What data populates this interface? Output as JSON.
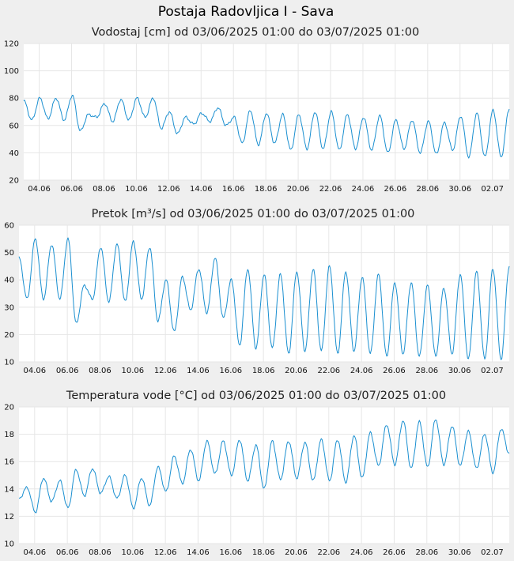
{
  "page": {
    "title": "Postaja Radovljica I - Sava"
  },
  "colors": {
    "series": "#1a8fd0",
    "background": "#efefef",
    "plot": "#ffffff",
    "grid": "#e6e6e6"
  },
  "chart_data": [
    {
      "type": "line",
      "title": "Vodostaj [cm] od 03/06/2025 01:00 do 03/07/2025 01:00",
      "xlabel": "",
      "ylabel": "",
      "ylim": [
        20,
        120
      ],
      "yticks": [
        "20",
        "40",
        "60",
        "80",
        "100",
        "120"
      ],
      "xticks": [
        "04.06",
        "06.06",
        "08.06",
        "10.06",
        "12.06",
        "14.06",
        "16.06",
        "18.06",
        "20.06",
        "22.06",
        "24.06",
        "26.06",
        "28.06",
        "30.06",
        "02.07"
      ],
      "grid": true,
      "x": [
        "03.06",
        "03.06 12h",
        "04.06",
        "04.06 12h",
        "05.06",
        "05.06 12h",
        "06.06",
        "06.06 12h",
        "07.06",
        "07.06 12h",
        "08.06",
        "08.06 12h",
        "09.06",
        "09.06 12h",
        "10.06",
        "10.06 12h",
        "11.06",
        "11.06 12h",
        "12.06",
        "12.06 12h",
        "13.06",
        "13.06 12h",
        "14.06",
        "14.06 12h",
        "15.06",
        "15.06 12h",
        "16.06",
        "16.06 12h",
        "17.06",
        "17.06 12h",
        "18.06",
        "18.06 12h",
        "19.06",
        "19.06 12h",
        "20.06",
        "20.06 12h",
        "21.06",
        "21.06 12h",
        "22.06",
        "22.06 12h",
        "23.06",
        "23.06 12h",
        "24.06",
        "24.06 12h",
        "25.06",
        "25.06 12h",
        "26.06",
        "26.06 12h",
        "27.06",
        "27.06 12h",
        "28.06",
        "28.06 12h",
        "29.06",
        "29.06 12h",
        "30.06",
        "30.06 12h",
        "01.07",
        "01.07 12h",
        "02.07",
        "02.07 12h",
        "03.07"
      ],
      "series": [
        {
          "values": [
            78,
            64,
            80,
            65,
            80,
            64,
            82,
            56,
            68,
            66,
            76,
            63,
            79,
            64,
            80,
            66,
            80,
            58,
            70,
            54,
            66,
            61,
            69,
            63,
            73,
            60,
            66,
            47,
            71,
            46,
            69,
            47,
            68,
            42,
            68,
            43,
            70,
            43,
            70,
            42,
            68,
            43,
            66,
            42,
            67,
            40,
            64,
            43,
            64,
            40,
            63,
            39,
            62,
            42,
            67,
            37,
            69,
            37,
            71,
            37,
            72
          ]
        }
      ]
    },
    {
      "type": "line",
      "title": "Pretok [m³/s] od 03/06/2025 01:00 do 03/07/2025 01:00",
      "xlabel": "",
      "ylabel": "",
      "ylim": [
        10,
        60
      ],
      "yticks": [
        "10",
        "20",
        "30",
        "40",
        "50",
        "60"
      ],
      "xticks": [
        "04.06",
        "06.06",
        "08.06",
        "10.06",
        "12.06",
        "14.06",
        "16.06",
        "18.06",
        "20.06",
        "22.06",
        "24.06",
        "26.06",
        "28.06",
        "30.06",
        "02.07"
      ],
      "grid": true,
      "x": [
        "03.06",
        "03.06 12h",
        "04.06",
        "04.06 12h",
        "05.06",
        "05.06 12h",
        "06.06",
        "06.06 12h",
        "07.06",
        "07.06 12h",
        "08.06",
        "08.06 12h",
        "09.06",
        "09.06 12h",
        "10.06",
        "10.06 12h",
        "11.06",
        "11.06 12h",
        "12.06",
        "12.06 12h",
        "13.06",
        "13.06 12h",
        "14.06",
        "14.06 12h",
        "15.06",
        "15.06 12h",
        "16.06",
        "16.06 12h",
        "17.06",
        "17.06 12h",
        "18.06",
        "18.06 12h",
        "19.06",
        "19.06 12h",
        "20.06",
        "20.06 12h",
        "21.06",
        "21.06 12h",
        "22.06",
        "22.06 12h",
        "23.06",
        "23.06 12h",
        "24.06",
        "24.06 12h",
        "25.06",
        "25.06 12h",
        "26.06",
        "26.06 12h",
        "27.06",
        "27.06 12h",
        "28.06",
        "28.06 12h",
        "29.06",
        "29.06 12h",
        "30.06",
        "30.06 12h",
        "01.07",
        "01.07 12h",
        "02.07",
        "02.07 12h",
        "03.07"
      ],
      "series": [
        {
          "values": [
            48,
            33,
            55,
            33,
            53,
            33,
            55,
            24,
            38,
            33,
            52,
            32,
            53,
            32,
            54,
            33,
            52,
            25,
            40,
            21,
            41,
            29,
            44,
            28,
            48,
            26,
            40,
            16,
            44,
            15,
            42,
            15,
            42,
            13,
            43,
            14,
            44,
            14,
            45,
            13,
            43,
            14,
            41,
            13,
            42,
            12,
            39,
            13,
            39,
            12,
            38,
            12,
            37,
            13,
            42,
            11,
            43,
            11,
            44,
            11,
            45
          ]
        }
      ]
    },
    {
      "type": "line",
      "title": "Temperatura vode [°C] od 03/06/2025 01:00 do 03/07/2025 01:00",
      "xlabel": "",
      "ylabel": "",
      "ylim": [
        10,
        20
      ],
      "yticks": [
        "10",
        "12",
        "14",
        "16",
        "18",
        "20"
      ],
      "xticks": [
        "04.06",
        "06.06",
        "08.06",
        "10.06",
        "12.06",
        "14.06",
        "16.06",
        "18.06",
        "20.06",
        "22.06",
        "24.06",
        "26.06",
        "28.06",
        "30.06",
        "02.07"
      ],
      "grid": true,
      "x": [
        "03.06",
        "03.06 12h",
        "04.06",
        "04.06 12h",
        "05.06",
        "05.06 12h",
        "06.06",
        "06.06 12h",
        "07.06",
        "07.06 12h",
        "08.06",
        "08.06 12h",
        "09.06",
        "09.06 12h",
        "10.06",
        "10.06 12h",
        "11.06",
        "11.06 12h",
        "12.06",
        "12.06 12h",
        "13.06",
        "13.06 12h",
        "14.06",
        "14.06 12h",
        "15.06",
        "15.06 12h",
        "16.06",
        "16.06 12h",
        "17.06",
        "17.06 12h",
        "18.06",
        "18.06 12h",
        "19.06",
        "19.06 12h",
        "20.06",
        "20.06 12h",
        "21.06",
        "21.06 12h",
        "22.06",
        "22.06 12h",
        "23.06",
        "23.06 12h",
        "24.06",
        "24.06 12h",
        "25.06",
        "25.06 12h",
        "26.06",
        "26.06 12h",
        "27.06",
        "27.06 12h",
        "28.06",
        "28.06 12h",
        "29.06",
        "29.06 12h",
        "30.06",
        "30.06 12h",
        "01.07",
        "01.07 12h",
        "02.07",
        "02.07 12h",
        "03.07"
      ],
      "series": [
        {
          "values": [
            13.3,
            14.1,
            12.3,
            14.8,
            13.1,
            14.6,
            12.6,
            15.4,
            13.5,
            15.5,
            13.7,
            14.9,
            13.3,
            15.0,
            12.6,
            14.8,
            12.8,
            15.6,
            13.8,
            16.4,
            14.4,
            16.9,
            14.6,
            17.5,
            15.1,
            17.5,
            15.0,
            17.6,
            14.6,
            17.2,
            14.0,
            17.5,
            14.7,
            17.5,
            14.8,
            17.4,
            14.6,
            17.6,
            14.6,
            17.6,
            14.5,
            17.9,
            14.8,
            18.1,
            15.7,
            18.7,
            15.8,
            19.0,
            15.5,
            18.9,
            15.6,
            19.1,
            15.8,
            18.6,
            15.7,
            18.2,
            15.5,
            18.0,
            15.2,
            18.4,
            16.6
          ]
        }
      ]
    }
  ]
}
